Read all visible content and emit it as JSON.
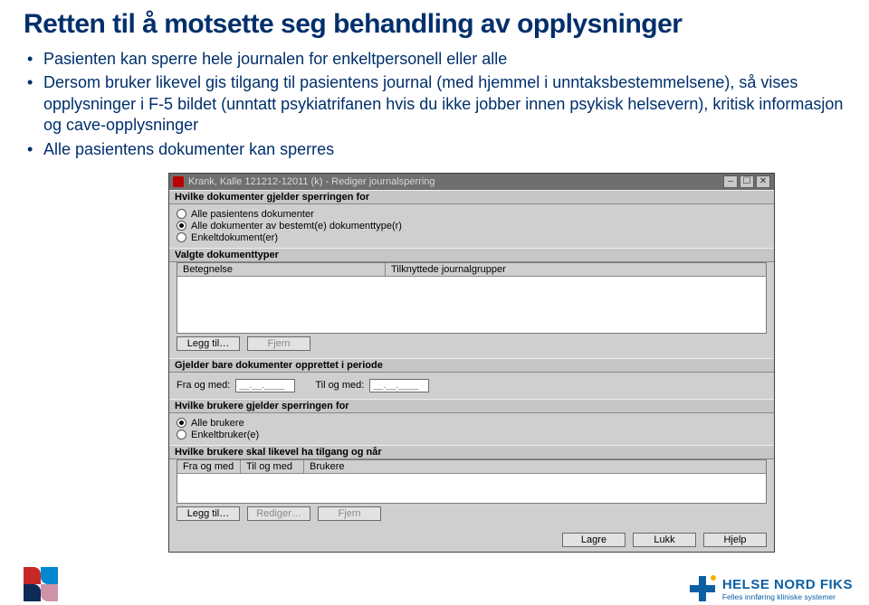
{
  "headline": "Retten til å motsette seg behandling av opplysninger",
  "bullets": [
    "Pasienten kan sperre hele journalen for enkeltpersonell eller alle",
    "Dersom bruker likevel gis tilgang til pasientens journal (med hjemmel i unntaksbestemmelsene), så vises opplysninger i F-5 bildet (unntatt psykiatrifanen hvis du ikke jobber innen psykisk helsevern), kritisk informasjon og cave-opplysninger",
    "Alle pasientens dokumenter kan sperres"
  ],
  "dialog": {
    "title": "Krank, Kalle 121212-12011 (k) - Rediger journalsperring",
    "group1": {
      "heading": "Hvilke dokumenter gjelder sperringen for",
      "opt1": "Alle pasientens dokumenter",
      "opt2": "Alle dokumenter av bestemt(e) dokumenttype(r)",
      "opt3": "Enkeltdokument(er)"
    },
    "group2": {
      "heading": "Valgte dokumenttyper",
      "col1": "Betegnelse",
      "col2": "Tilknyttede journalgrupper"
    },
    "btns": {
      "add": "Legg til…",
      "remove": "Fjern",
      "edit": "Rediger…"
    },
    "period": {
      "heading": "Gjelder bare dokumenter opprettet i periode",
      "from": "Fra og med:",
      "to": "Til og med:",
      "date_placeholder": "__.__.____"
    },
    "users": {
      "heading": "Hvilke brukere gjelder sperringen for",
      "opt1": "Alle brukere",
      "opt2": "Enkeltbruker(e)"
    },
    "exc": {
      "heading": "Hvilke brukere skal likevel ha tilgang og når",
      "col1": "Fra og med",
      "col2": "Til og med",
      "col3": "Brukere"
    },
    "bottom": {
      "save": "Lagre",
      "close": "Lukk",
      "help": "Hjelp"
    }
  },
  "brand": {
    "l1": "HELSE NORD FIKS",
    "l2": "Felles innføring kliniske systemer"
  }
}
